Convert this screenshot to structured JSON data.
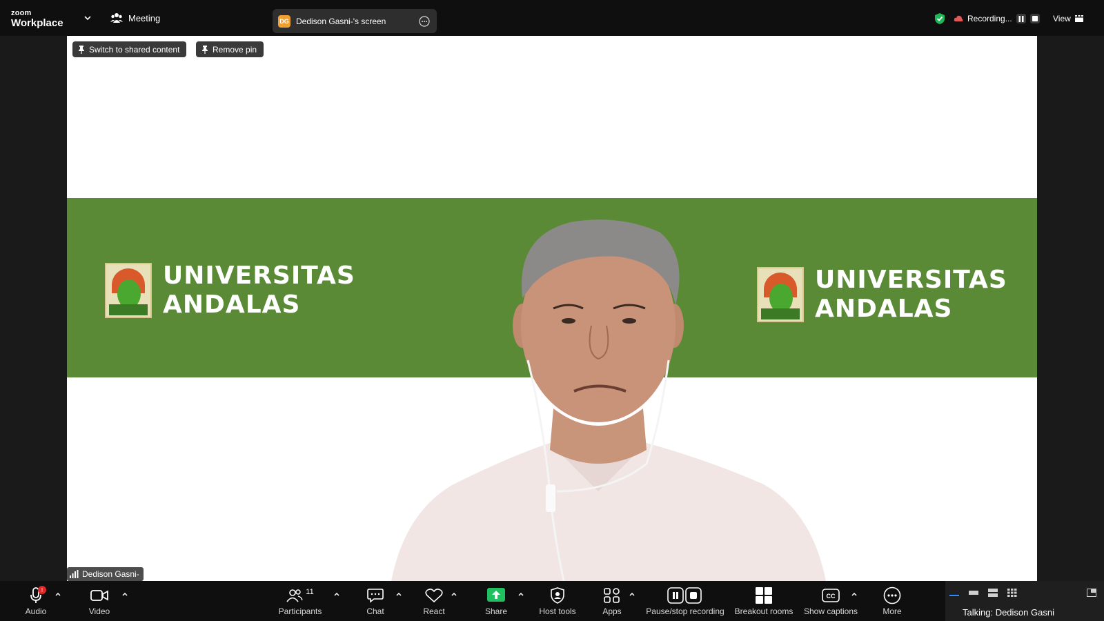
{
  "topbar": {
    "brand_line1": "zoom",
    "brand_line2": "Workplace",
    "meeting_label": "Meeting",
    "share_initials": "DG",
    "share_title": "Dedison Gasni-'s screen",
    "recording_label": "Recording...",
    "view_label": "View"
  },
  "stage": {
    "switch_button": "Switch to shared content",
    "remove_pin_button": "Remove pin",
    "university_line1": "UNIVERSITAS",
    "university_line2": "ANDALAS",
    "banner_color": "#5a8a36"
  },
  "participant": {
    "name_tag": "Dedison Gasni-"
  },
  "toolbar": {
    "audio": "Audio",
    "audio_badge": "!",
    "video": "Video",
    "participants": "Participants",
    "participants_count": "11",
    "chat": "Chat",
    "react": "React",
    "share": "Share",
    "host_tools": "Host tools",
    "apps": "Apps",
    "pause_stop": "Pause/stop recording",
    "breakout": "Breakout rooms",
    "captions": "Show captions",
    "more": "More",
    "talking": "Talking: Dedison Gasni",
    "share_color": "#20c060"
  }
}
